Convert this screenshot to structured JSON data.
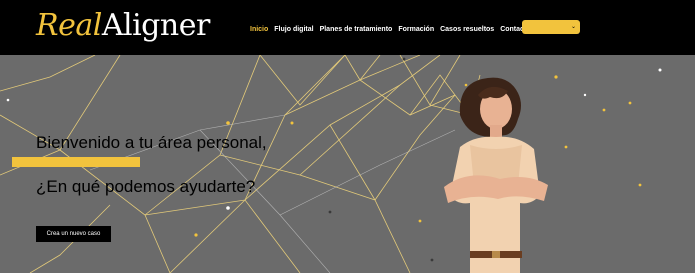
{
  "brand": {
    "name_part1": "Real",
    "name_part2": "Aligner"
  },
  "nav": {
    "items": [
      {
        "label": "Inicio",
        "active": true
      },
      {
        "label": "Flujo digital",
        "active": false
      },
      {
        "label": "Planes de tratamiento",
        "active": false
      },
      {
        "label": "Formación",
        "active": false
      },
      {
        "label": "Casos resueltos",
        "active": false
      },
      {
        "label": "Contacto",
        "active": false
      }
    ],
    "dropdown_icon": "chevron-down-icon"
  },
  "hero": {
    "title": "Bienvenido a tu área personal,",
    "subtitle": "¿En qué podemos ayudarte?",
    "cta_label": "Crea un nuevo caso"
  },
  "colors": {
    "accent": "#f2c33d",
    "header_bg": "#000000",
    "hero_bg": "#6b6b6b"
  }
}
